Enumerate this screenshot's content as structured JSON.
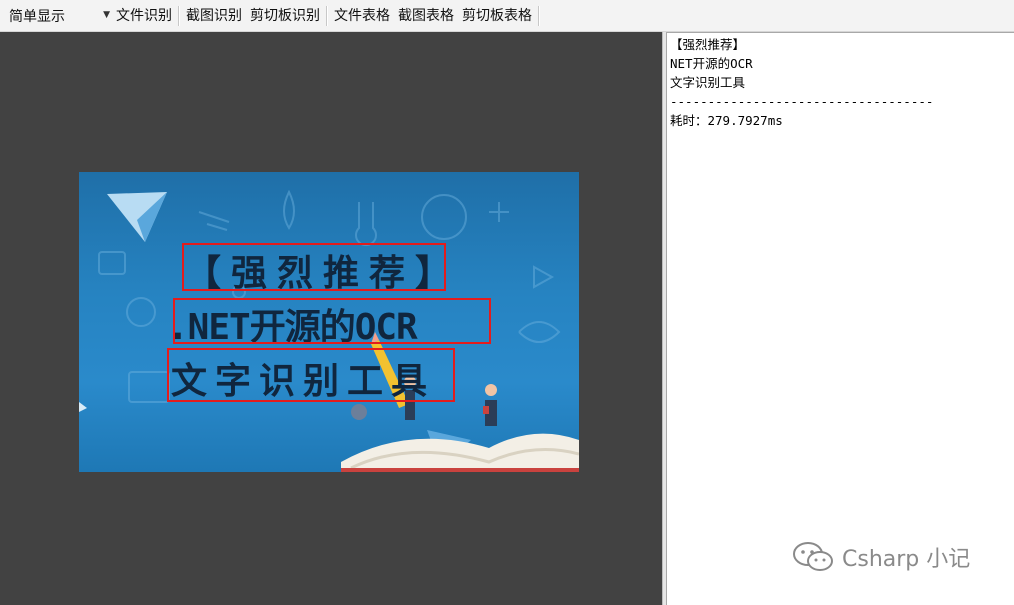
{
  "toolbar": {
    "mode_select": "简单显示",
    "buttons": [
      "文件识别",
      "截图识别",
      "剪切板识别",
      "文件表格",
      "截图表格",
      "剪切板表格"
    ]
  },
  "image": {
    "lines": [
      "【强烈推荐】",
      ".NET开源的OCR",
      "文字识别工具"
    ]
  },
  "result": {
    "lines": [
      "【强烈推荐】",
      "NET开源的OCR",
      "文字识别工具",
      "-----------------------------------",
      "耗时：279.7927ms"
    ]
  },
  "watermark": {
    "text": "Csharp 小记"
  },
  "colors": {
    "preview_bg": "#424242",
    "bbox": "#e41c1c",
    "image_blue": "#2683c1"
  }
}
